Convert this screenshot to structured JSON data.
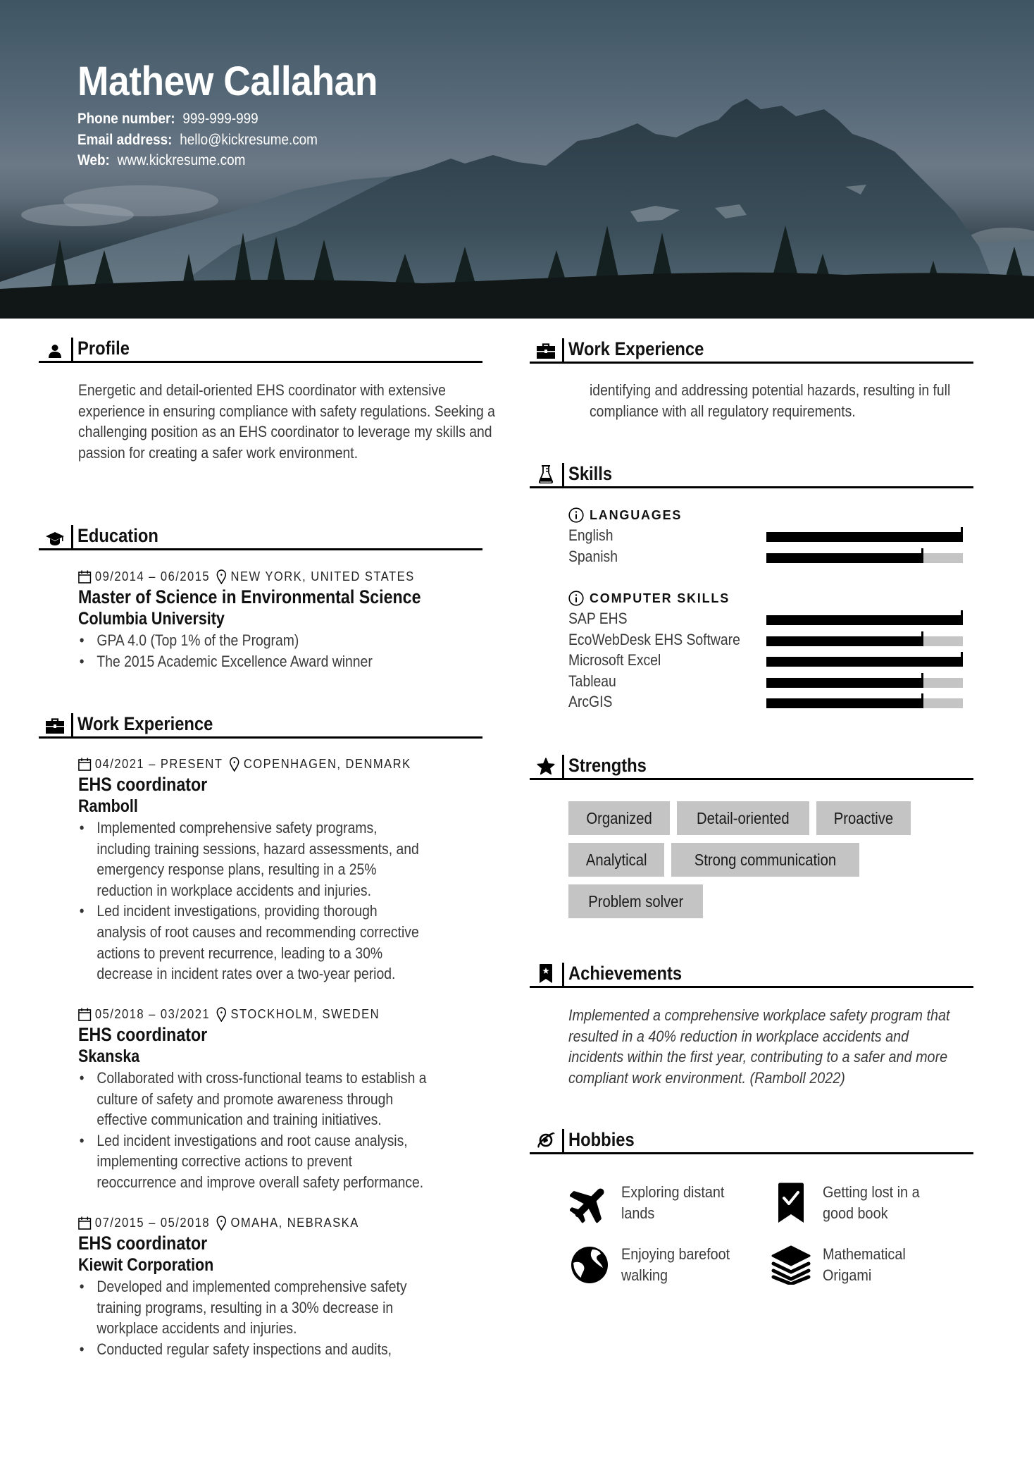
{
  "header": {
    "name": "Mathew Callahan",
    "contacts": [
      {
        "label": "Phone number:",
        "value": "999-999-999"
      },
      {
        "label": "Email address:",
        "value": "hello@kickresume.com"
      },
      {
        "label": "Web:",
        "value": "www.kickresume.com"
      }
    ]
  },
  "profile": {
    "title": "Profile",
    "icon": "user-icon",
    "text": "Energetic and detail-oriented EHS coordinator with extensive experience in ensuring compliance with safety regulations. Seeking a challenging position as an EHS coordinator to leverage my skills and passion for creating a safer work environment."
  },
  "education": {
    "title": "Education",
    "icon": "graduation-cap-icon",
    "entries": [
      {
        "dates": "09/2014 – 06/2015",
        "location": "NEW YORK, UNITED STATES",
        "degree": "Master of Science in Environmental Science",
        "school": "Columbia University",
        "bullets": [
          "GPA 4.0 (Top 1% of the Program)",
          "The 2015 Academic Excellence Award winner"
        ]
      }
    ]
  },
  "work": {
    "title": "Work Experience",
    "icon": "briefcase-icon",
    "entries": [
      {
        "dates": "04/2021 – PRESENT",
        "location": "COPENHAGEN, DENMARK",
        "role": "EHS coordinator",
        "company": "Ramboll",
        "bullets": [
          "Implemented comprehensive safety programs,\nincluding training sessions, hazard assessments, and\nemergency response plans, resulting in a 25%\nreduction in workplace accidents and injuries.",
          "Led incident investigations, providing thorough\nanalysis of root causes and recommending corrective\nactions to prevent recurrence, leading to a 30%\ndecrease in incident rates over a two-year period."
        ]
      },
      {
        "dates": "05/2018 – 03/2021",
        "location": "STOCKHOLM, SWEDEN",
        "role": "EHS coordinator",
        "company": "Skanska",
        "bullets": [
          "Collaborated with cross-functional teams to establish a\nculture of safety and promote awareness through\neffective communication and training initiatives.",
          "Led incident investigations and root cause analysis,\nimplementing corrective actions to prevent\nreoccurrence and improve overall safety performance."
        ]
      },
      {
        "dates": "07/2015 – 05/2018",
        "location": "OMAHA, NEBRASKA",
        "role": "EHS coordinator",
        "company": "Kiewit Corporation",
        "bullets": [
          "Developed and implemented comprehensive safety\ntraining programs, resulting in a 30% decrease in\nworkplace accidents and injuries.",
          "Conducted regular safety inspections and audits,"
        ]
      }
    ],
    "continued_text": "identifying and addressing potential hazards, resulting in full compliance with all regulatory requirements."
  },
  "skills": {
    "title": "Skills",
    "icon": "flask-icon",
    "categories": [
      {
        "name": "LANGUAGES",
        "items": [
          {
            "name": "English",
            "level": 1.0
          },
          {
            "name": "Spanish",
            "level": 0.8
          }
        ]
      },
      {
        "name": "COMPUTER SKILLS",
        "items": [
          {
            "name": "SAP EHS",
            "level": 1.0
          },
          {
            "name": "EcoWebDesk EHS Software",
            "level": 0.8
          },
          {
            "name": "Microsoft Excel",
            "level": 1.0
          },
          {
            "name": "Tableau",
            "level": 0.8
          },
          {
            "name": "ArcGIS",
            "level": 0.8
          }
        ]
      }
    ]
  },
  "strengths": {
    "title": "Strengths",
    "icon": "star-icon",
    "tags": [
      "Organized",
      "Detail-oriented",
      "Proactive",
      "Analytical",
      "Strong communication",
      "Problem solver"
    ]
  },
  "achievements": {
    "title": "Achievements",
    "icon": "bookmark-star-icon",
    "text": "Implemented a comprehensive workplace safety program that resulted in a 40% reduction in workplace accidents and incidents within the first year, contributing to a safer and more compliant work environment. (Ramboll 2022)"
  },
  "hobbies": {
    "title": "Hobbies",
    "icon": "planet-icon",
    "items": [
      {
        "label": "Exploring distant lands",
        "icon": "airplane-icon"
      },
      {
        "label": "Getting lost in a good book",
        "icon": "bookmark-check-icon"
      },
      {
        "label": "Enjoying barefoot walking",
        "icon": "globe-icon"
      },
      {
        "label": "Mathematical Origami",
        "icon": "layers-icon"
      }
    ]
  },
  "colors": {
    "text": "#3a3a3a",
    "heading": "#111111",
    "rule": "#000000",
    "bar_fill": "#000000",
    "bar_track": "#c4c4c4",
    "tag_bg": "#c4c4c4"
  }
}
